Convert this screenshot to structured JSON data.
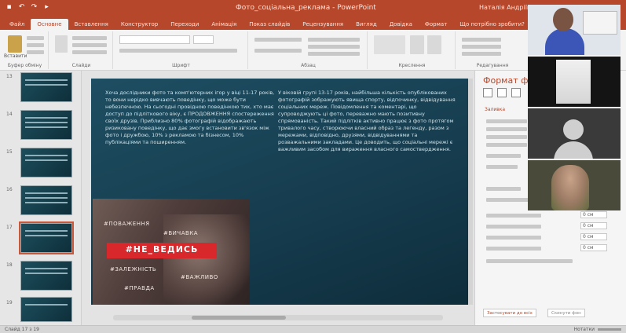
{
  "titlebar": {
    "doc_title": "Фото_соціальна_реклама - PowerPoint",
    "user_name": "Наталія Андріївна"
  },
  "quick_access": {
    "save_icon": "save-icon",
    "undo_icon": "undo-icon",
    "redo_icon": "redo-icon",
    "start_icon": "slideshow-icon"
  },
  "tabs": [
    {
      "label": "Файл"
    },
    {
      "label": "Основне"
    },
    {
      "label": "Вставлення"
    },
    {
      "label": "Конструктор"
    },
    {
      "label": "Переходи"
    },
    {
      "label": "Анімація"
    },
    {
      "label": "Показ слайдів"
    },
    {
      "label": "Рецензування"
    },
    {
      "label": "Вигляд"
    },
    {
      "label": "Довідка"
    },
    {
      "label": "Формат"
    },
    {
      "label": "Що потрібно зробити?"
    }
  ],
  "ribbon": {
    "paste_label": "Вставити",
    "groups": [
      "Буфер обміну",
      "Слайди",
      "Шрифт",
      "Абзац",
      "Креслення",
      "Редагування"
    ]
  },
  "thumbnails": {
    "numbers": [
      "13",
      "14",
      "15",
      "16",
      "17",
      "18",
      "19"
    ]
  },
  "slide": {
    "left_text": "Хоча дослідники фото та комп'ютерних ігор у віці 11-17 років, то вони нерідко вивчають поведінку, що може бути небезпечною. На сьогодні провідною поведінкою тих, хто має доступ до підліткового віку, є ПРОДОВЖЕННЯ спостереження своїх друзів. Приблизно 80% фотографій відображають ризиковану поведінку, що дає змогу встановити зв'язок між фото і дружбою, 10% з рекламою та бізнесом, 10% публікаціями та поширенням.",
    "right_text": "У віковій групі 13-17 років, найбільша кількість опублікованих фотографій зображують явища спорту, відпочинку, відвідування соціальних мереж. Повідомлення та коментарі, що супроводжують ці фото, переважно мають позитивну спрямованість. Такий підлітків активно працює з фото протягом тривалого часу, створюючи власний образ та легенду, разом з мережами, відповідно, друзями, відвідуваннями та розважальними закладами. Це доводить, що соціальні мережі є важливим засобом для вираження власного самоствердження.",
    "tags": [
      "#ПОВАЖЕННЯ",
      "#ВИЧАВКА",
      "#НЕ_ВЕДИСЬ",
      "#ЗАЛЕЖНІСТЬ",
      "#ВАЖЛИВО",
      "#ПРАВДА"
    ],
    "banner": "#НЕ_ВЕДИСЬ"
  },
  "format_pane": {
    "title": "Формат фону",
    "section": "Заливка",
    "inputs": [
      "0 см",
      "0 см",
      "0 см",
      "0 см"
    ],
    "apply_label": "Застосувати до всіх",
    "reset_label": "Скинути фон"
  },
  "status": {
    "slide_info": "Слайд 17 з 19",
    "language": "українська",
    "notes": "Нотатки",
    "comments": "Примітки"
  }
}
